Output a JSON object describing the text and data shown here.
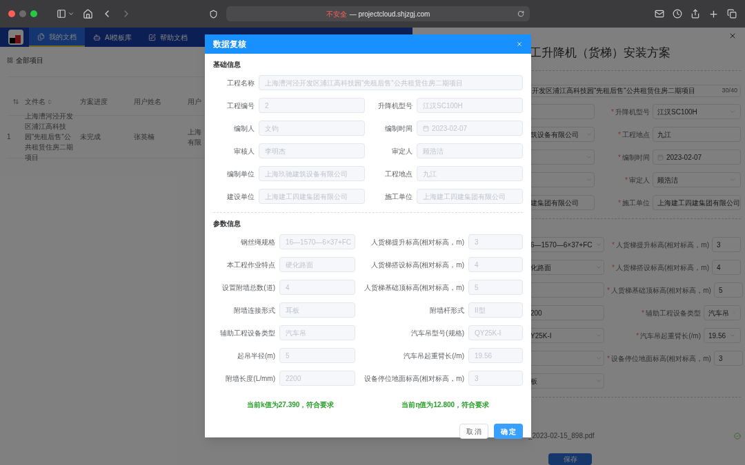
{
  "browser": {
    "security_label": "不安全",
    "address": "— projectcloud.shjzgj.com"
  },
  "nav": {
    "tabs": [
      {
        "label": "我的文档",
        "selected": true
      },
      {
        "label": "AI模板库",
        "selected": false
      },
      {
        "label": "帮助文档",
        "selected": false
      }
    ]
  },
  "projects": {
    "title": "全部项目",
    "columns": [
      "文件名",
      "方案进度",
      "用户姓名",
      "用户"
    ],
    "rows": [
      {
        "index": "1",
        "file_name": "上海漕河泾开发区浦江高科技园“先租后售“公共租赁住房二期项目",
        "progress": "未完成",
        "user_name": "张英楠",
        "column_4": [
          "上海",
          "有限"
        ]
      }
    ]
  },
  "drawer": {
    "heading": "工升降机（货梯）安装方案",
    "project_name": {
      "value": "开发区浦江高科技园“先租后售“公共租赁住房二期项目",
      "count": "30/40"
    },
    "basic_rows": [
      {
        "left": {
          "kind": "input"
        },
        "right": {
          "marker": "*",
          "label": "升降机型号",
          "value": "江汉SC100H",
          "kind": "select"
        }
      },
      {
        "left": {
          "kind": "select",
          "value": "筑设备有限公司"
        },
        "right": {
          "marker": "*",
          "label": "工程地点",
          "value": "九江",
          "kind": "input"
        }
      },
      {
        "left": {
          "kind": "select"
        },
        "right": {
          "marker": "*",
          "label": "编制时间",
          "value": "2023-02-07",
          "kind": "date"
        }
      },
      {
        "left": {
          "kind": "select"
        },
        "right": {
          "marker": "*",
          "label": "审定人",
          "value": "顾浩洁",
          "kind": "select"
        }
      },
      {
        "left": {
          "kind": "input",
          "value": "建集团有限公司"
        },
        "right": {
          "marker": "*",
          "label": "施工单位",
          "value": "上海建工四建集团有限公司",
          "kind": "select"
        }
      }
    ],
    "param_rows": [
      {
        "left": {
          "kind": "select",
          "value": "6—1570—6×37+FC"
        },
        "right": {
          "marker": "*",
          "label": "人货梯提升标高(相对标高，m)",
          "value": "3",
          "kind": "input"
        }
      },
      {
        "left": {
          "kind": "select",
          "value": "化路面"
        },
        "right": {
          "marker": "*",
          "label": "人货梯搭设标高(相对标高，m)",
          "value": "4",
          "kind": "input"
        }
      },
      {
        "left": {
          "kind": "input"
        },
        "right": {
          "marker": "*",
          "label": "人货梯基础顶标高(相对标高，m)",
          "value": "5",
          "kind": "input"
        }
      },
      {
        "left": {
          "kind": "input",
          "value": "200"
        },
        "right": {
          "marker": "*",
          "label": "辅助工程设备类型",
          "value": "汽车吊",
          "kind": "select"
        }
      },
      {
        "left": {
          "kind": "select",
          "value": "Y25K-I"
        },
        "right": {
          "marker": "*",
          "label": "汽车吊起重臂长(/m)",
          "value": "19.56",
          "kind": "select"
        }
      },
      {
        "left": {
          "kind": "select"
        },
        "right": {
          "marker": "*",
          "label": "设备停位地面标高(相对标高，m)",
          "value": "3",
          "kind": "input"
        }
      },
      {
        "left": {
          "kind": "select",
          "value": "板"
        }
      }
    ],
    "file": "_2023-02-15_898.pdf",
    "save": "保存"
  },
  "modal": {
    "title": "数据复核",
    "sections": [
      {
        "title": "基础信息",
        "fields": [
          {
            "label": "工程名称",
            "value": "上海漕河泾开发区浦江高科技园“先租后售“公共租赁住房二期项目",
            "kind": "wide"
          },
          {
            "label": "工程编号",
            "value": "2",
            "kind": "text"
          },
          {
            "label": "升降机型号",
            "value": "江汉SC100H",
            "kind": "text"
          },
          {
            "label": "编制人",
            "value": "文钧",
            "kind": "text"
          },
          {
            "label": "编制时间",
            "value": "2023-02-07",
            "kind": "date"
          },
          {
            "label": "审核人",
            "value": "李明杰",
            "kind": "text"
          },
          {
            "label": "审定人",
            "value": "顾浩洁",
            "kind": "text"
          },
          {
            "label": "编制单位",
            "value": "上海玖驰建筑设备有限公司",
            "kind": "text"
          },
          {
            "label": "工程地点",
            "value": "九江",
            "kind": "text"
          },
          {
            "label": "建设单位",
            "value": "上海建工四建集团有限公司",
            "kind": "text"
          },
          {
            "label": "施工单位",
            "value": "上海建工四建集团有限公司",
            "kind": "text"
          }
        ]
      },
      {
        "title": "参数信息",
        "fields": [
          {
            "label": "钢丝绳规格",
            "value": "16—1570—6×37+FC",
            "kind": "text"
          },
          {
            "label": "人货梯提升标高(相对标高，m)",
            "value": "3",
            "kind": "text"
          },
          {
            "label": "本工程作业特点",
            "value": "硬化路面",
            "kind": "text"
          },
          {
            "label": "人货梯搭设标高(相对标高，m)",
            "value": "4",
            "kind": "text"
          },
          {
            "label": "设置附墙总数(道)",
            "value": "4",
            "kind": "text"
          },
          {
            "label": "人货梯基础顶标高(相对标高，m)",
            "value": "5",
            "kind": "text"
          },
          {
            "label": "附墙连接形式",
            "value": "耳板",
            "kind": "text"
          },
          {
            "label": "附墙杆形式",
            "value": "II型",
            "kind": "text"
          },
          {
            "label": "辅助工程设备类型",
            "value": "汽车吊",
            "kind": "text"
          },
          {
            "label": "汽车吊型号(规格)",
            "value": "QY25K-I",
            "kind": "text"
          },
          {
            "label": "起吊半径(m)",
            "value": "5",
            "kind": "text"
          },
          {
            "label": "汽车吊起重臂长(/m)",
            "value": "19.56",
            "kind": "text"
          },
          {
            "label": "附墙长度(L/mm)",
            "value": "2200",
            "kind": "text"
          },
          {
            "label": "设备停位地面标高(相对标高，m)",
            "value": "3",
            "kind": "text"
          }
        ]
      }
    ],
    "messages": [
      "当前k值为27.390，符合要求",
      "当前η值为12.800，符合要求"
    ],
    "buttons": [
      {
        "label": "取 消",
        "kind": "cancel"
      },
      {
        "label": "确 定",
        "kind": "primary"
      }
    ]
  }
}
